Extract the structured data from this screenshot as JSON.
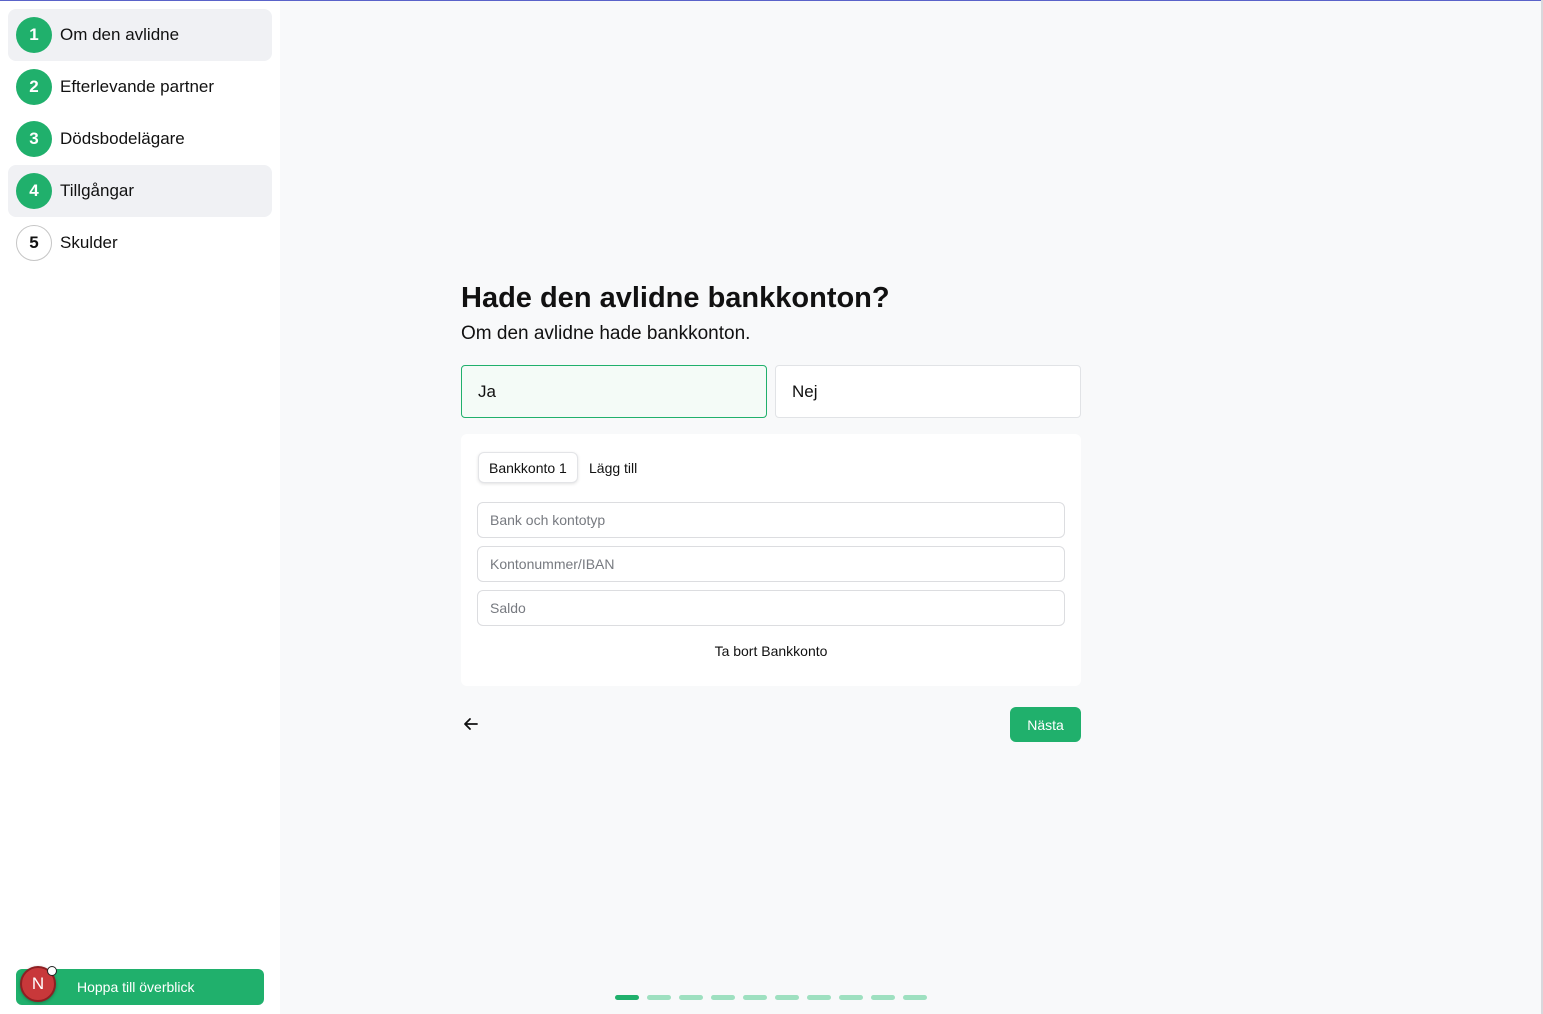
{
  "steps": [
    {
      "number": "1",
      "label": "Om den avlidne"
    },
    {
      "number": "2",
      "label": "Efterlevande partner"
    },
    {
      "number": "3",
      "label": "Dödsbodelägare"
    },
    {
      "number": "4",
      "label": "Tillgångar"
    },
    {
      "number": "5",
      "label": "Skulder"
    }
  ],
  "overview_button": {
    "label": "Hoppa till överblick"
  },
  "avatar": {
    "initial": "N"
  },
  "question": {
    "title": "Hade den avlidne bankkonton?",
    "subtitle": "Om den avlidne hade bankkonton.",
    "options": {
      "yes": "Ja",
      "no": "Nej"
    },
    "selected": "Ja"
  },
  "accounts": {
    "tabs": {
      "active": "Bankkonto 1",
      "add": "Lägg till"
    },
    "fields": {
      "bank_placeholder": "Bank och kontotyp",
      "account_placeholder": "Kontonummer/IBAN",
      "balance_placeholder": "Saldo"
    },
    "remove_label": "Ta bort Bankkonto"
  },
  "nav": {
    "next_label": "Nästa"
  },
  "progress": {
    "total_segments": 10,
    "completed_segments": 1
  },
  "colors": {
    "accent": "#20b06c",
    "accent_light": "#9ee0c0",
    "background": "#f8f9fa"
  }
}
